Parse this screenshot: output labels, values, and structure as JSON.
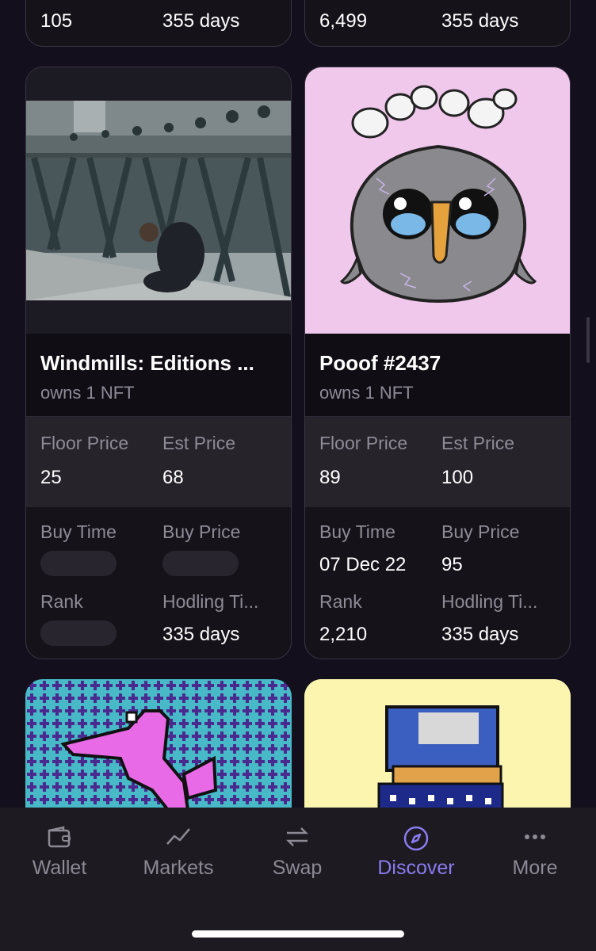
{
  "top_row": [
    {
      "left_value": "105",
      "right_value": "355 days"
    },
    {
      "left_value": "6,499",
      "right_value": "355 days"
    }
  ],
  "cards": [
    {
      "title": "Windmills: Editions ...",
      "owns": "owns 1 NFT",
      "floor_price_label": "Floor Price",
      "floor_price": "25",
      "est_price_label": "Est Price",
      "est_price": "68",
      "buy_time_label": "Buy Time",
      "buy_time": "",
      "buy_price_label": "Buy Price",
      "buy_price": "",
      "rank_label": "Rank",
      "rank": "",
      "hodling_label": "Hodling Ti...",
      "hodling": "335 days"
    },
    {
      "title": "Pooof #2437",
      "owns": "owns 1 NFT",
      "floor_price_label": "Floor Price",
      "floor_price": "89",
      "est_price_label": "Est Price",
      "est_price": "100",
      "buy_time_label": "Buy Time",
      "buy_time": "07 Dec 22",
      "buy_price_label": "Buy Price",
      "buy_price": "95",
      "rank_label": "Rank",
      "rank": "2,210",
      "hodling_label": "Hodling Ti...",
      "hodling": "335 days"
    }
  ],
  "poof_lettering": "Pooof",
  "nav": {
    "wallet": "Wallet",
    "markets": "Markets",
    "swap": "Swap",
    "discover": "Discover",
    "more": "More",
    "active": "discover"
  },
  "colors": {
    "background": "#140f1c",
    "accent": "#8a7cf0",
    "card_border": "#3a3544",
    "muted_text": "#8f8b97"
  },
  "icons": [
    "wallet-icon",
    "markets-icon",
    "swap-icon",
    "discover-icon",
    "more-icon"
  ]
}
